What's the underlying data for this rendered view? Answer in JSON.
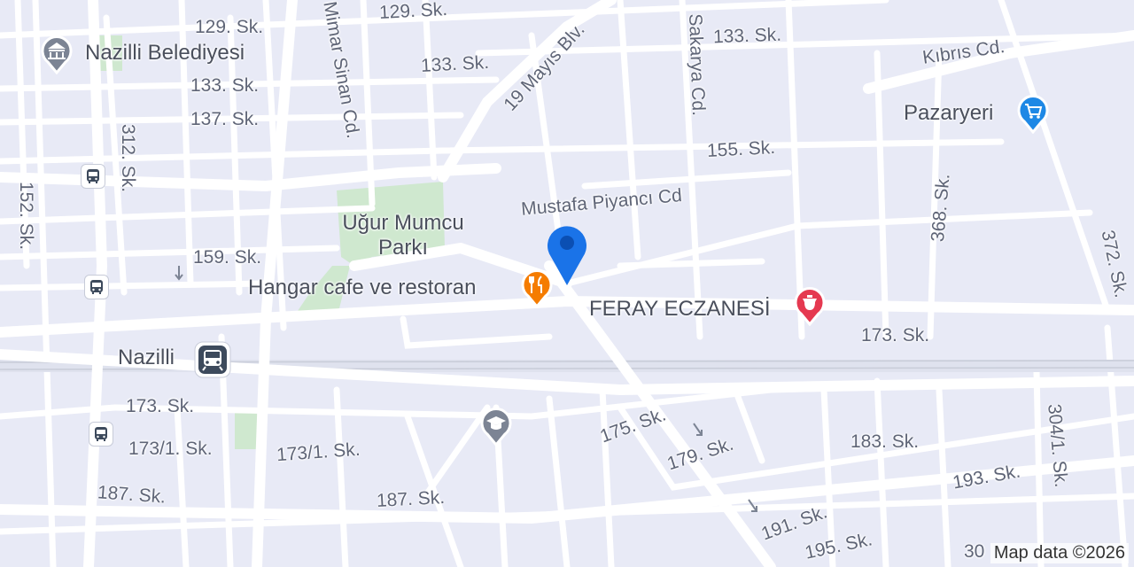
{
  "places": {
    "belediye": "Nazilli Belediyesi",
    "pazaryeri": "Pazaryeri",
    "park": "Uğur Mumcu Parkı",
    "hangar": "Hangar cafe ve restoran",
    "eczane": "FERAY ECZANESİ",
    "station": "Nazilli"
  },
  "streets": {
    "s129a": "129. Sk.",
    "s129b": "129. Sk.",
    "s133a": "133. Sk.",
    "s133b": "133. Sk.",
    "s133c": "133. Sk.",
    "s137": "137. Sk.",
    "s312": "312. Sk.",
    "s152": "152. Sk.",
    "s159": "159. Sk.",
    "mimar": "Mimar Sinan Cd.",
    "mayis": "19 Mayıs Blv.",
    "sakarya": "Sakarya Cd.",
    "kibris": "Kıbrıs Cd.",
    "s155": "155. Sk.",
    "piyanci": "Mustafa Piyancı Cd",
    "s368": "368. Sk.",
    "s372": "372. Sk.",
    "s173a": "173. Sk.",
    "s173b": "173. Sk.",
    "s1731a": "173/1. Sk.",
    "s1731b": "173/1. Sk.",
    "s175": "175. Sk.",
    "s179": "179. Sk.",
    "s183": "183. Sk.",
    "s187a": "187. Sk.",
    "s187b": "187. Sk.",
    "s193": "193. Sk.",
    "s3041": "304/1. Sk.",
    "s191": "191. Sk.",
    "s195": "195. Sk.",
    "s30": "30"
  },
  "attribution": "Map data ©2026",
  "colors": {
    "background": "#e8eaf6",
    "road": "#ffffff",
    "park": "#cfe8cf",
    "location_pin": "#1a73e8",
    "food_pin": "#f57c00",
    "pharmacy_pin": "#e53950",
    "shopping_pin": "#1e88e5",
    "civic_pin": "#7c8494",
    "transit": "#3d4a5c"
  },
  "icons": [
    "location-pin-icon",
    "restaurant-icon",
    "pharmacy-icon",
    "shopping-cart-icon",
    "government-building-icon",
    "school-icon",
    "bus-icon",
    "train-icon"
  ]
}
